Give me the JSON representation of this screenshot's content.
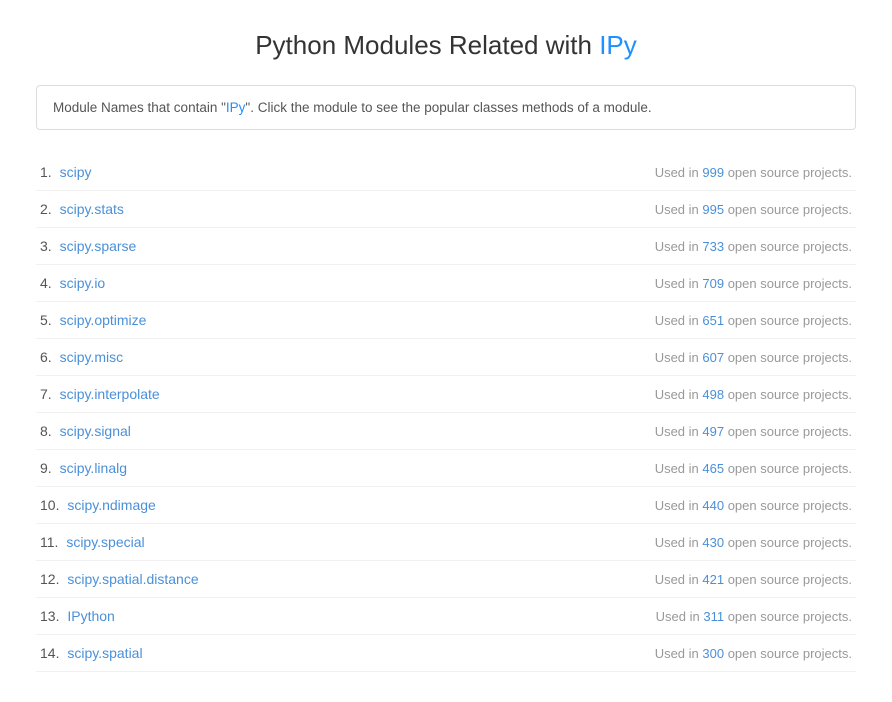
{
  "page": {
    "title_prefix": "Python Modules Related with ",
    "title_highlight": "IPy",
    "info_text_before": "Module Names that contain \"",
    "info_highlight": "IPy",
    "info_text_after": "\". Click the module to see the popular classes methods of a module."
  },
  "modules": [
    {
      "rank": "1.",
      "name": "scipy",
      "count": "999"
    },
    {
      "rank": "2.",
      "name": "scipy.stats",
      "count": "995"
    },
    {
      "rank": "3.",
      "name": "scipy.sparse",
      "count": "733"
    },
    {
      "rank": "4.",
      "name": "scipy.io",
      "count": "709"
    },
    {
      "rank": "5.",
      "name": "scipy.optimize",
      "count": "651"
    },
    {
      "rank": "6.",
      "name": "scipy.misc",
      "count": "607"
    },
    {
      "rank": "7.",
      "name": "scipy.interpolate",
      "count": "498"
    },
    {
      "rank": "8.",
      "name": "scipy.signal",
      "count": "497"
    },
    {
      "rank": "9.",
      "name": "scipy.linalg",
      "count": "465"
    },
    {
      "rank": "10.",
      "name": "scipy.ndimage",
      "count": "440"
    },
    {
      "rank": "11.",
      "name": "scipy.special",
      "count": "430"
    },
    {
      "rank": "12.",
      "name": "scipy.spatial.distance",
      "count": "421"
    },
    {
      "rank": "13.",
      "name": "IPython",
      "count": "311"
    },
    {
      "rank": "14.",
      "name": "scipy.spatial",
      "count": "300"
    }
  ],
  "usage_label": "Used in",
  "usage_suffix": "open source projects."
}
